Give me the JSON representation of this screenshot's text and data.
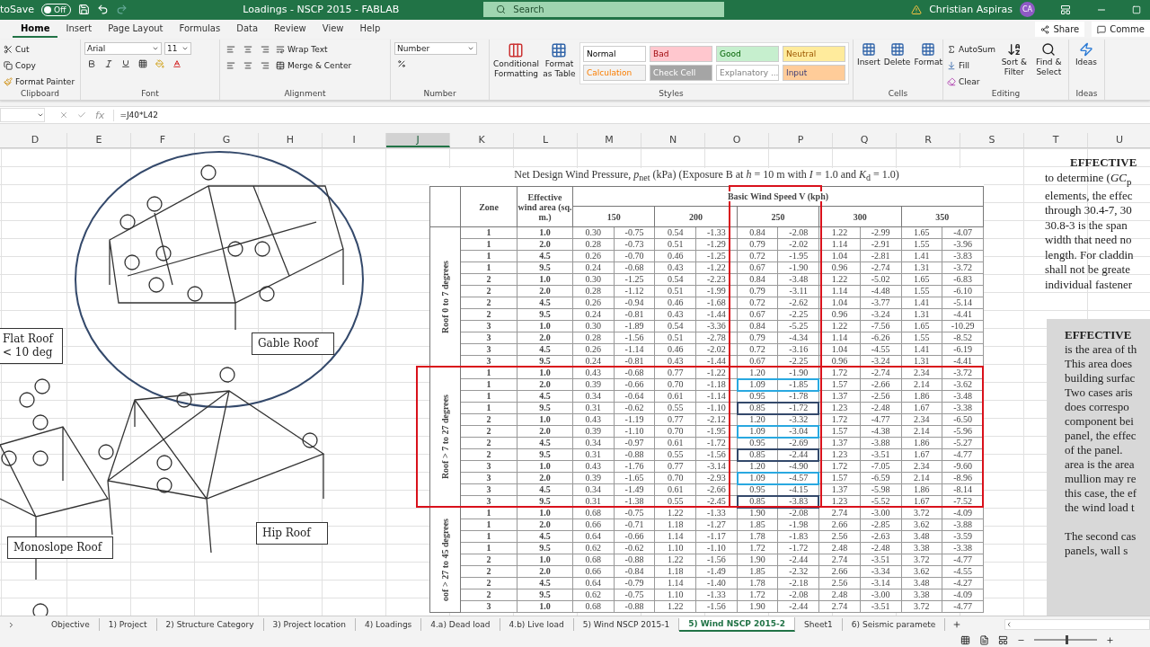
{
  "title_bar": {
    "autosave_label": "toSave",
    "autosave": {
      "on": false,
      "label": "Off"
    },
    "title": "Loadings - NSCP 2015 - FABLAB",
    "search_placeholder": "Search",
    "user": "Christian Aspiras",
    "initials": "CA"
  },
  "menu_tabs": [
    {
      "label": "Home",
      "selected": true
    },
    {
      "label": "Insert",
      "selected": false
    },
    {
      "label": "Page Layout",
      "selected": false
    },
    {
      "label": "Formulas",
      "selected": false
    },
    {
      "label": "Data",
      "selected": false
    },
    {
      "label": "Review",
      "selected": false
    },
    {
      "label": "View",
      "selected": false
    },
    {
      "label": "Help",
      "selected": false
    }
  ],
  "share": "Share",
  "comments": "Comme",
  "ribbon": {
    "clipboard": {
      "label": "Clipboard",
      "cut": "Cut",
      "copy": "Copy",
      "format_painter": "Format Painter"
    },
    "font": {
      "label": "Font",
      "font_name": "Arial",
      "font_size": "11"
    },
    "alignment": {
      "label": "Alignment",
      "wrap": "Wrap Text",
      "merge": "Merge & Center"
    },
    "number": {
      "label": "Number",
      "format": "Number"
    },
    "styles": {
      "label": "Styles",
      "conditional": "Conditional Formatting",
      "format_table": "Format as Table",
      "cells": [
        {
          "label": "Normal",
          "kind": "normal"
        },
        {
          "label": "Bad",
          "kind": "bad"
        },
        {
          "label": "Good",
          "kind": "good"
        },
        {
          "label": "Neutral",
          "kind": "neutral"
        },
        {
          "label": "Calculation",
          "kind": "calculation"
        },
        {
          "label": "Check Cell",
          "kind": "check"
        },
        {
          "label": "Explanatory ...",
          "kind": "explanatory"
        },
        {
          "label": "Input",
          "kind": "input"
        }
      ]
    },
    "cells": {
      "label": "Cells",
      "insert": "Insert",
      "delete": "Delete",
      "format": "Format"
    },
    "editing": {
      "label": "Editing",
      "autosum": "AutoSum",
      "fill": "Fill",
      "clear": "Clear",
      "sort": "Sort & Filter",
      "find": "Find & Select"
    },
    "ideas": {
      "label": "Ideas",
      "button": "Ideas"
    }
  },
  "formula_bar": {
    "function_label": "fx",
    "formula": "=J40*L42"
  },
  "columns": [
    {
      "label": "D",
      "selected": false
    },
    {
      "label": "E",
      "selected": false
    },
    {
      "label": "F",
      "selected": false
    },
    {
      "label": "G",
      "selected": false
    },
    {
      "label": "H",
      "selected": false
    },
    {
      "label": "I",
      "selected": false
    },
    {
      "label": "J",
      "selected": true
    },
    {
      "label": "K",
      "selected": false
    },
    {
      "label": "L",
      "selected": false
    },
    {
      "label": "M",
      "selected": false
    },
    {
      "label": "N",
      "selected": false
    },
    {
      "label": "O",
      "selected": false
    },
    {
      "label": "P",
      "selected": false
    },
    {
      "label": "Q",
      "selected": false
    },
    {
      "label": "R",
      "selected": false
    },
    {
      "label": "S",
      "selected": false
    },
    {
      "label": "T",
      "selected": false
    },
    {
      "label": "U",
      "selected": false
    }
  ],
  "roof_labels": [
    "Flat Roof < 10 deg",
    "Gable Roof",
    "Hip Roof",
    "Monoslope Roof"
  ],
  "wind_table": {
    "title": "Net Design Wind Pressure, *p*$_{net}$ (kPa) (Exposure B at *h* = 10 m with *I* = 1.0 and *K*$_{d}$ = 1.0)",
    "zone_header": "Zone",
    "area_header": "Effective wind area (sq. m.)",
    "speed_header": "Basic Wind Speed V (kph)",
    "speeds": [
      "150",
      "200",
      "250",
      "300",
      "350"
    ],
    "groups": [
      {
        "label": "Roof 0 to 7 degrees",
        "rows": [
          {
            "zone": "1",
            "area": "1.0",
            "values": [
              "0.30",
              "-0.75",
              "0.54",
              "-1.33",
              "0.84",
              "-2.08",
              "1.22",
              "-2.99",
              "1.65",
              "-4.07"
            ]
          },
          {
            "zone": "1",
            "area": "2.0",
            "values": [
              "0.28",
              "-0.73",
              "0.51",
              "-1.29",
              "0.79",
              "-2.02",
              "1.14",
              "-2.91",
              "1.55",
              "-3.96"
            ]
          },
          {
            "zone": "1",
            "area": "4.5",
            "values": [
              "0.26",
              "-0.70",
              "0.46",
              "-1.25",
              "0.72",
              "-1.95",
              "1.04",
              "-2.81",
              "1.41",
              "-3.83"
            ]
          },
          {
            "zone": "1",
            "area": "9.5",
            "values": [
              "0.24",
              "-0.68",
              "0.43",
              "-1.22",
              "0.67",
              "-1.90",
              "0.96",
              "-2.74",
              "1.31",
              "-3.72"
            ]
          },
          {
            "zone": "2",
            "area": "1.0",
            "values": [
              "0.30",
              "-1.25",
              "0.54",
              "-2.23",
              "0.84",
              "-3.48",
              "1.22",
              "-5.02",
              "1.65",
              "-6.83"
            ]
          },
          {
            "zone": "2",
            "area": "2.0",
            "values": [
              "0.28",
              "-1.12",
              "0.51",
              "-1.99",
              "0.79",
              "-3.11",
              "1.14",
              "-4.48",
              "1.55",
              "-6.10"
            ]
          },
          {
            "zone": "2",
            "area": "4.5",
            "values": [
              "0.26",
              "-0.94",
              "0.46",
              "-1.68",
              "0.72",
              "-2.62",
              "1.04",
              "-3.77",
              "1.41",
              "-5.14"
            ]
          },
          {
            "zone": "2",
            "area": "9.5",
            "values": [
              "0.24",
              "-0.81",
              "0.43",
              "-1.44",
              "0.67",
              "-2.25",
              "0.96",
              "-3.24",
              "1.31",
              "-4.41"
            ]
          },
          {
            "zone": "3",
            "area": "1.0",
            "values": [
              "0.30",
              "-1.89",
              "0.54",
              "-3.36",
              "0.84",
              "-5.25",
              "1.22",
              "-7.56",
              "1.65",
              "-10.29"
            ]
          },
          {
            "zone": "3",
            "area": "2.0",
            "values": [
              "0.28",
              "-1.56",
              "0.51",
              "-2.78",
              "0.79",
              "-4.34",
              "1.14",
              "-6.26",
              "1.55",
              "-8.52"
            ]
          },
          {
            "zone": "3",
            "area": "4.5",
            "values": [
              "0.26",
              "-1.14",
              "0.46",
              "-2.02",
              "0.72",
              "-3.16",
              "1.04",
              "-4.55",
              "1.41",
              "-6.19"
            ]
          },
          {
            "zone": "3",
            "area": "9.5",
            "values": [
              "0.24",
              "-0.81",
              "0.43",
              "-1.44",
              "0.67",
              "-2.25",
              "0.96",
              "-3.24",
              "1.31",
              "-4.41"
            ]
          }
        ]
      },
      {
        "label": "Roof > 7  to 27 degrees",
        "rows": [
          {
            "zone": "1",
            "area": "1.0",
            "values": [
              "0.43",
              "-0.68",
              "0.77",
              "-1.22",
              "1.20",
              "-1.90",
              "1.72",
              "-2.74",
              "2.34",
              "-3.72"
            ]
          },
          {
            "zone": "1",
            "area": "2.0",
            "color": "#29a8e0",
            "values": [
              "0.39",
              "-0.66",
              "0.70",
              "-1.18",
              "1.09",
              "-1.85",
              "1.57",
              "-2.66",
              "2.14",
              "-3.62"
            ]
          },
          {
            "zone": "1",
            "area": "4.5",
            "values": [
              "0.34",
              "-0.64",
              "0.61",
              "-1.14",
              "0.95",
              "-1.78",
              "1.37",
              "-2.56",
              "1.86",
              "-3.48"
            ]
          },
          {
            "zone": "1",
            "area": "9.5",
            "color": "#34496b",
            "values": [
              "0.31",
              "-0.62",
              "0.55",
              "-1.10",
              "0.85",
              "-1.72",
              "1.23",
              "-2.48",
              "1.67",
              "-3.38"
            ]
          },
          {
            "zone": "2",
            "area": "1.0",
            "values": [
              "0.43",
              "-1.19",
              "0.77",
              "-2.12",
              "1.20",
              "-3.32",
              "1.72",
              "-4.77",
              "2.34",
              "-6.50"
            ]
          },
          {
            "zone": "2",
            "area": "2.0",
            "color": "#29a8e0",
            "values": [
              "0.39",
              "-1.10",
              "0.70",
              "-1.95",
              "1.09",
              "-3.04",
              "1.57",
              "-4.38",
              "2.14",
              "-5.96"
            ]
          },
          {
            "zone": "2",
            "area": "4.5",
            "values": [
              "0.34",
              "-0.97",
              "0.61",
              "-1.72",
              "0.95",
              "-2.69",
              "1.37",
              "-3.88",
              "1.86",
              "-5.27"
            ]
          },
          {
            "zone": "2",
            "area": "9.5",
            "color": "#34496b",
            "values": [
              "0.31",
              "-0.88",
              "0.55",
              "-1.56",
              "0.85",
              "-2.44",
              "1.23",
              "-3.51",
              "1.67",
              "-4.77"
            ]
          },
          {
            "zone": "3",
            "area": "1.0",
            "values": [
              "0.43",
              "-1.76",
              "0.77",
              "-3.14",
              "1.20",
              "-4.90",
              "1.72",
              "-7.05",
              "2.34",
              "-9.60"
            ]
          },
          {
            "zone": "3",
            "area": "2.0",
            "color": "#29a8e0",
            "values": [
              "0.39",
              "-1.65",
              "0.70",
              "-2.93",
              "1.09",
              "-4.57",
              "1.57",
              "-6.59",
              "2.14",
              "-8.96"
            ]
          },
          {
            "zone": "3",
            "area": "4.5",
            "values": [
              "0.34",
              "-1.49",
              "0.61",
              "-2.66",
              "0.95",
              "-4.15",
              "1.37",
              "-5.98",
              "1.86",
              "-8.14"
            ]
          },
          {
            "zone": "3",
            "area": "9.5",
            "color": "#34496b",
            "values": [
              "0.31",
              "-1.38",
              "0.55",
              "-2.45",
              "0.85",
              "-3.83",
              "1.23",
              "-5.52",
              "1.67",
              "-7.52"
            ]
          }
        ]
      },
      {
        "label": "oof > 27 to 45 degrees",
        "rows": [
          {
            "zone": "1",
            "area": "1.0",
            "values": [
              "0.68",
              "-0.75",
              "1.22",
              "-1.33",
              "1.90",
              "-2.08",
              "2.74",
              "-3.00",
              "3.72",
              "-4.09"
            ]
          },
          {
            "zone": "1",
            "area": "2.0",
            "values": [
              "0.66",
              "-0.71",
              "1.18",
              "-1.27",
              "1.85",
              "-1.98",
              "2.66",
              "-2.85",
              "3.62",
              "-3.88"
            ]
          },
          {
            "zone": "1",
            "area": "4.5",
            "values": [
              "0.64",
              "-0.66",
              "1.14",
              "-1.17",
              "1.78",
              "-1.83",
              "2.56",
              "-2.63",
              "3.48",
              "-3.59"
            ]
          },
          {
            "zone": "1",
            "area": "9.5",
            "values": [
              "0.62",
              "-0.62",
              "1.10",
              "-1.10",
              "1.72",
              "-1.72",
              "2.48",
              "-2.48",
              "3.38",
              "-3.38"
            ]
          },
          {
            "zone": "2",
            "area": "1.0",
            "values": [
              "0.68",
              "-0.88",
              "1.22",
              "-1.56",
              "1.90",
              "-2.44",
              "2.74",
              "-3.51",
              "3.72",
              "-4.77"
            ]
          },
          {
            "zone": "2",
            "area": "2.0",
            "values": [
              "0.66",
              "-0.84",
              "1.18",
              "-1.49",
              "1.85",
              "-2.32",
              "2.66",
              "-3.34",
              "3.62",
              "-4.55"
            ]
          },
          {
            "zone": "2",
            "area": "4.5",
            "values": [
              "0.64",
              "-0.79",
              "1.14",
              "-1.40",
              "1.78",
              "-2.18",
              "2.56",
              "-3.14",
              "3.48",
              "-4.27"
            ]
          },
          {
            "zone": "2",
            "area": "9.5",
            "values": [
              "0.62",
              "-0.75",
              "1.10",
              "-1.33",
              "1.72",
              "-2.08",
              "2.48",
              "-3.00",
              "3.38",
              "-4.09"
            ]
          },
          {
            "zone": "3",
            "area": "1.0",
            "values": [
              "0.68",
              "-0.88",
              "1.22",
              "-1.56",
              "1.90",
              "-2.44",
              "2.74",
              "-3.51",
              "3.72",
              "-4.77"
            ]
          }
        ]
      }
    ]
  },
  "side_text": {
    "heading": "EFFECTIVE",
    "lines": [
      "to determine (*GC*$_{p}$",
      "elements, the effec",
      "through 30.4-7, 30",
      "30.8-3 is the span",
      "width that need no",
      "length. For claddin",
      "shall not be greate",
      "individual fastener"
    ]
  },
  "scan_text": {
    "heading": "EFFECTIVE",
    "lines": [
      "is the area of th",
      "This area does",
      "building surfac",
      "Two cases aris",
      "does  correspo",
      "component bei",
      "panel, the effec",
      "of the panel.",
      "area is the area",
      "mullion may re",
      "this case, the ef",
      "the wind load t"
    ],
    "lines_2": [
      "The second cas",
      "panels,  wall  s"
    ]
  },
  "sheet_tabs": [
    {
      "label": "Objective",
      "selected": false
    },
    {
      "label": "1) Project",
      "selected": false
    },
    {
      "label": "2) Structure Category",
      "selected": false
    },
    {
      "label": "3) Project location",
      "selected": false
    },
    {
      "label": "4) Loadings",
      "selected": false
    },
    {
      "label": "4.a) Dead load",
      "selected": false
    },
    {
      "label": "4.b) Live load",
      "selected": false
    },
    {
      "label": "5) Wind NSCP 2015-1",
      "selected": false
    },
    {
      "label": "5) Wind NSCP 2015-2",
      "selected": true
    },
    {
      "label": "Sheet1",
      "selected": false
    },
    {
      "label": "6) Seismic paramete",
      "selected": false
    }
  ],
  "zoom": {
    "level": 0.5
  }
}
